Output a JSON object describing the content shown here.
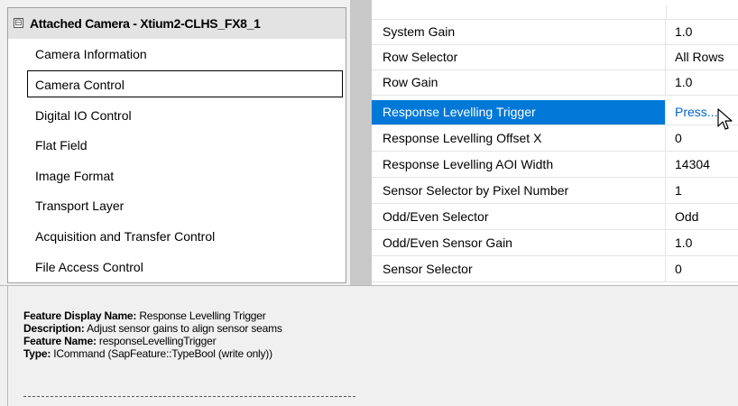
{
  "tree": {
    "toggle": "⊟",
    "title": "Attached Camera - Xtium2-CLHS_FX8_1",
    "items": [
      {
        "label": "Camera Information"
      },
      {
        "label": "Camera Control"
      },
      {
        "label": "Digital IO Control"
      },
      {
        "label": "Flat Field"
      },
      {
        "label": "Image Format"
      },
      {
        "label": "Transport Layer"
      },
      {
        "label": "Acquisition and Transfer Control"
      },
      {
        "label": "File Access Control"
      }
    ],
    "selected_index": 1
  },
  "grid": {
    "rows": [
      {
        "name": "System Gain",
        "value": "1.0"
      },
      {
        "name": "Row Selector",
        "value": "All Rows"
      },
      {
        "name": "Row Gain",
        "value": "1.0"
      },
      {
        "name": "Response Levelling Trigger",
        "value": "Press..."
      },
      {
        "name": "Response Levelling Offset X",
        "value": "0"
      },
      {
        "name": "Response Levelling AOI Width",
        "value": "14304"
      },
      {
        "name": "Sensor Selector by Pixel Number",
        "value": "1"
      },
      {
        "name": "Odd/Even Selector",
        "value": "Odd"
      },
      {
        "name": "Odd/Even Sensor Gain",
        "value": "1.0"
      },
      {
        "name": "Sensor Selector",
        "value": "0"
      }
    ],
    "selected_index": 3
  },
  "description": {
    "display_name_label": "Feature Display Name:",
    "display_name_value": "Response Levelling Trigger",
    "description_label": "Description:",
    "description_value": "Adjust sensor gains to align sensor seams",
    "feature_name_label": "Feature Name:",
    "feature_name_value": "responseLevellingTrigger",
    "type_label": "Type:",
    "type_value": "ICommand (SapFeature::TypeBool (write only))"
  },
  "colors": {
    "selection": "#0078d7",
    "link_value": "#0066cc"
  }
}
